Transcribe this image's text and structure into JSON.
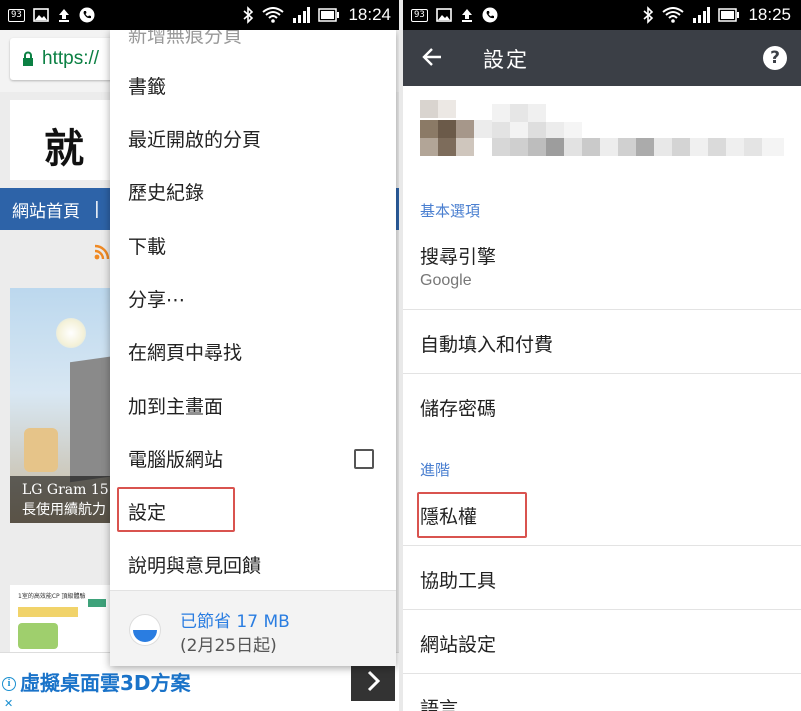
{
  "left": {
    "status": {
      "badge": "93",
      "time": "18:24"
    },
    "url": "https://",
    "site": {
      "logo": "就",
      "nav": [
        "網站首頁",
        "|"
      ],
      "card_caption_line1": "LG Gram 15.",
      "card_caption_line2": "長使用續航力",
      "card2_text": "1室的高效能CP 頂級體驗"
    },
    "menu": {
      "faded_top": "新增無痕分頁",
      "items": [
        "書籤",
        "最近開啟的分頁",
        "歷史紀錄",
        "下載",
        "分享⋯",
        "在網頁中尋找",
        "加到主畫面",
        "電腦版網站",
        "設定",
        "說明與意見回饋"
      ],
      "desktop_site_checked": false,
      "saver_line1": "已節省 17 MB",
      "saver_line2": "(2月25日起)"
    },
    "ad": {
      "info": "i",
      "close": "✕",
      "text": "虛擬桌面雲3D方案",
      "arrow": "›"
    }
  },
  "right": {
    "status": {
      "badge": "93",
      "time": "18:25"
    },
    "appbar": {
      "title": "設定",
      "help": "?"
    },
    "sections": {
      "basic": "基本選項",
      "advanced": "進階"
    },
    "items": {
      "search_engine": {
        "title": "搜尋引擎",
        "value": "Google"
      },
      "autofill": "自動填入和付費",
      "passwords": "儲存密碼",
      "privacy": "隱私權",
      "accessibility": "協助工具",
      "site_settings": "網站設定",
      "language": "語言"
    }
  },
  "colors": {
    "statusbar": "#000000",
    "appbar": "#3b3f46",
    "section_header": "#4a7fd0",
    "highlight": "#d9534f",
    "url_green": "#0b8043",
    "nav_blue": "#2d63a8"
  }
}
